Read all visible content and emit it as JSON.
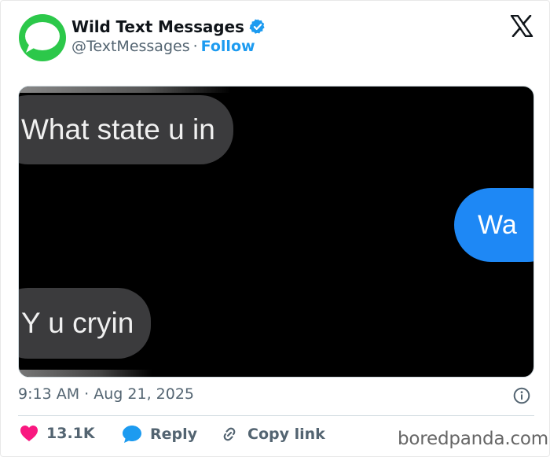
{
  "header": {
    "display_name": "Wild Text Messages",
    "handle": "@TextMessages",
    "separator": "·",
    "follow_label": "Follow"
  },
  "media": {
    "messages": [
      {
        "side": "left",
        "text": "What state u in"
      },
      {
        "side": "right",
        "text": "Wa"
      },
      {
        "side": "left",
        "text": "Y u cryin"
      }
    ]
  },
  "meta": {
    "time": "9:13 AM",
    "separator": "·",
    "date": "Aug 21, 2025"
  },
  "actions": {
    "likes": "13.1K",
    "reply_label": "Reply",
    "copy_label": "Copy link"
  },
  "watermark": "boredpanda.com",
  "colors": {
    "accent": "#1d9bf0",
    "like": "#f91880",
    "avatar_green": "#2cc84a",
    "sent_bubble": "#1e88f5",
    "received_bubble": "#3b3b3d"
  }
}
